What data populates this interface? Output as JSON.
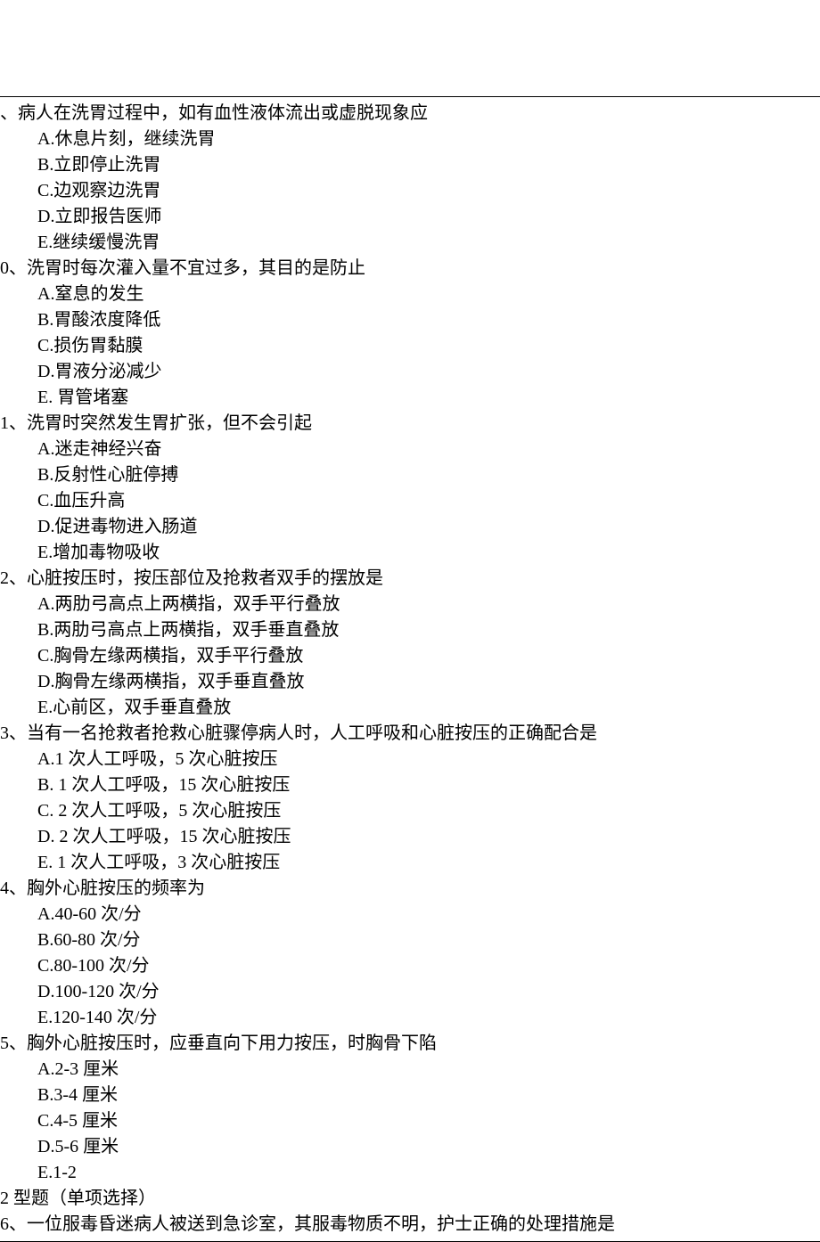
{
  "questions": [
    {
      "number": "",
      "text": "、病人在洗胃过程中，如有血性液体流出或虚脱现象应",
      "options": [
        "A.休息片刻，继续洗胃",
        "B.立即停止洗胃",
        "C.边观察边洗胃",
        "D.立即报告医师",
        "E.继续缓慢洗胃"
      ]
    },
    {
      "number": "0",
      "text": "、洗胃时每次灌入量不宜过多，其目的是防止",
      "options": [
        "A.窒息的发生",
        "B.胃酸浓度降低",
        "C.损伤胃黏膜",
        "D.胃液分泌减少",
        "E. 胃管堵塞"
      ]
    },
    {
      "number": "1",
      "text": "、洗胃时突然发生胃扩张，但不会引起",
      "options": [
        "A.迷走神经兴奋",
        "B.反射性心脏停搏",
        "C.血压升高",
        "D.促进毒物进入肠道",
        "E.增加毒物吸收"
      ]
    },
    {
      "number": "2",
      "text": "、心脏按压时，按压部位及抢救者双手的摆放是",
      "options": [
        "A.两肋弓高点上两横指，双手平行叠放",
        "B.两肋弓高点上两横指，双手垂直叠放",
        "C.胸骨左缘两横指，双手平行叠放",
        "D.胸骨左缘两横指，双手垂直叠放",
        "E.心前区，双手垂直叠放"
      ]
    },
    {
      "number": "3",
      "text": "、当有一名抢救者抢救心脏骤停病人时，人工呼吸和心脏按压的正确配合是",
      "options": [
        "A.1 次人工呼吸，5 次心脏按压",
        "B. 1 次人工呼吸，15 次心脏按压",
        "C. 2 次人工呼吸，5 次心脏按压",
        "D. 2 次人工呼吸，15 次心脏按压",
        "E. 1 次人工呼吸，3 次心脏按压"
      ]
    },
    {
      "number": "4",
      "text": "、胸外心脏按压的频率为",
      "options": [
        "A.40-60 次/分",
        "B.60-80 次/分",
        "C.80-100 次/分",
        "D.100-120 次/分",
        "E.120-140 次/分"
      ]
    },
    {
      "number": "5",
      "text": "、胸外心脏按压时，应垂直向下用力按压，时胸骨下陷",
      "options": [
        "A.2-3 厘米",
        "B.3-4 厘米",
        "C.4-5 厘米",
        "D.5-6 厘米",
        "E.1-2"
      ]
    }
  ],
  "section_header": "2 型题（单项选择）",
  "last_question": {
    "number": "6",
    "text": "、一位服毒昏迷病人被送到急诊室，其服毒物质不明，护士正确的处理措施是"
  }
}
